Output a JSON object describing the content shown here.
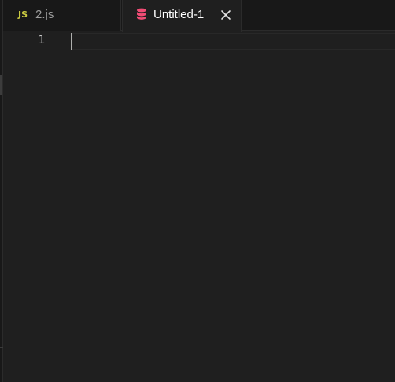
{
  "tabs": [
    {
      "icon": "js-file-icon",
      "icon_text": "JS",
      "label": "2.js",
      "active": false
    },
    {
      "icon": "database-icon",
      "label": "Untitled-1",
      "active": true,
      "close_glyph": "✕"
    }
  ],
  "editor": {
    "line_numbers": [
      "1"
    ],
    "content": ""
  },
  "colors": {
    "background": "#1f1f1f",
    "tabbar": "#181818",
    "js_icon": "#cbcb41",
    "db_icon": "#f14c75",
    "active_label": "#ffffff",
    "inactive_label": "#9d9d9d"
  }
}
